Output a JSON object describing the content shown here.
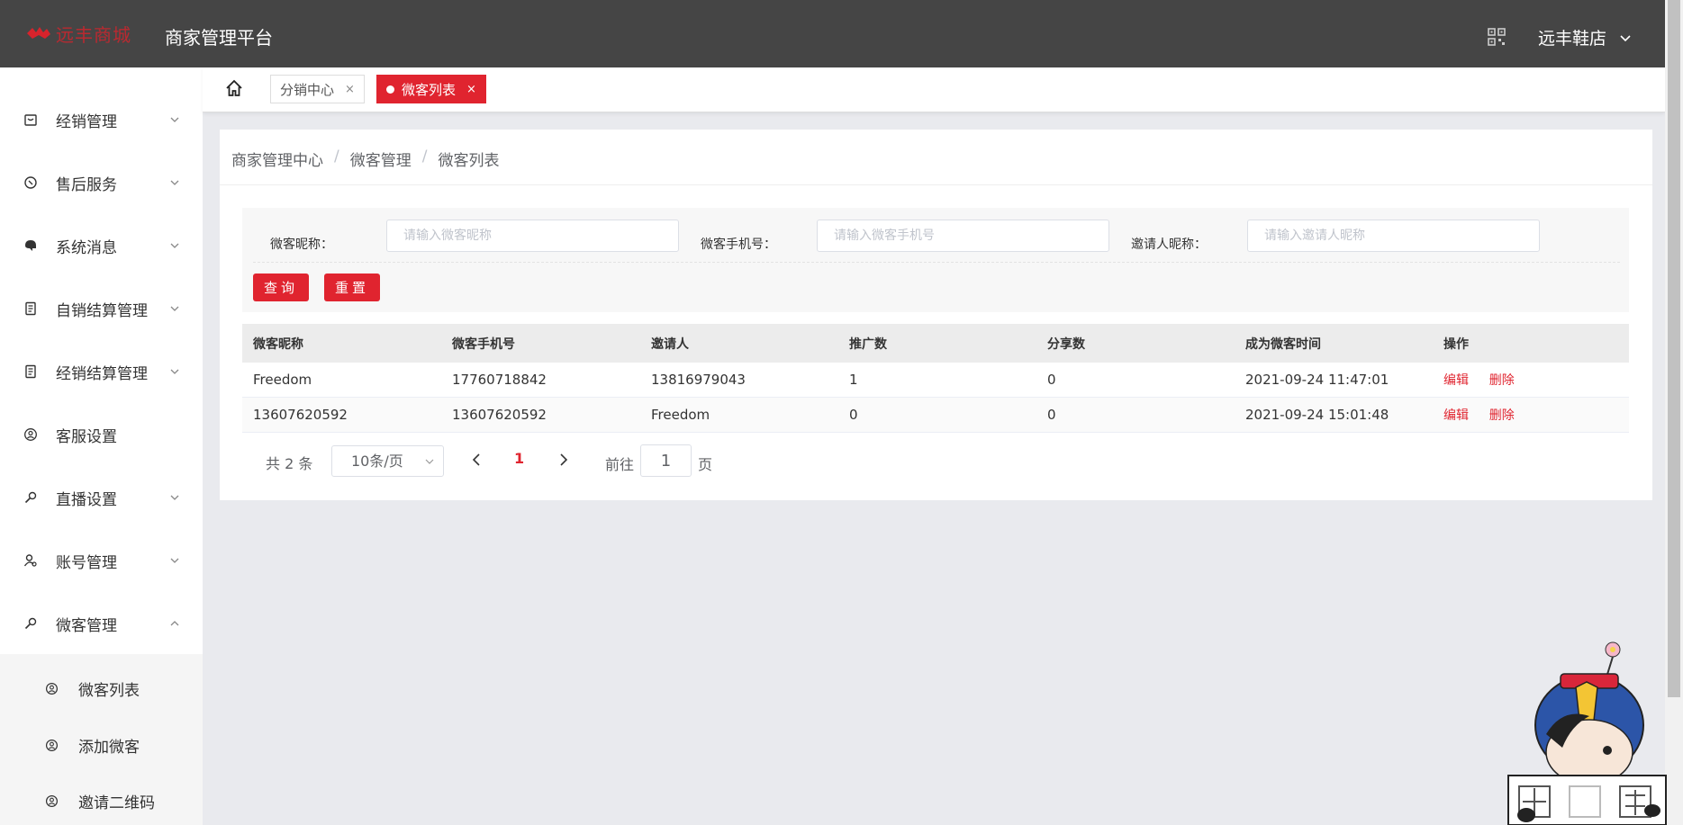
{
  "header": {
    "logo_text": "远丰商城",
    "platform_title": "商家管理平台",
    "shop_name": "远丰鞋店"
  },
  "sidebar": {
    "items": [
      {
        "label": "经销管理",
        "icon": "bag-icon",
        "expandable": true
      },
      {
        "label": "售后服务",
        "icon": "service-icon",
        "expandable": true
      },
      {
        "label": "系统消息",
        "icon": "message-icon",
        "expandable": true
      },
      {
        "label": "自销结算管理",
        "icon": "document-icon",
        "expandable": true
      },
      {
        "label": "经销结算管理",
        "icon": "document-icon",
        "expandable": true
      },
      {
        "label": "客服设置",
        "icon": "user-circle-icon",
        "expandable": false
      },
      {
        "label": "直播设置",
        "icon": "key-icon",
        "expandable": true
      },
      {
        "label": "账号管理",
        "icon": "account-icon",
        "expandable": true
      },
      {
        "label": "微客管理",
        "icon": "key-icon",
        "expandable": true,
        "expanded": true
      }
    ],
    "subitems": [
      {
        "label": "微客列表"
      },
      {
        "label": "添加微客"
      },
      {
        "label": "邀请二维码"
      }
    ]
  },
  "tabs": [
    {
      "label": "分销中心",
      "active": false
    },
    {
      "label": "微客列表",
      "active": true
    }
  ],
  "breadcrumb": [
    "商家管理中心",
    "微客管理",
    "微客列表"
  ],
  "filter": {
    "nickname_label": "微客昵称：",
    "nickname_placeholder": "请输入微客昵称",
    "phone_label": "微客手机号：",
    "phone_placeholder": "请输入微客手机号",
    "inviter_label": "邀请人昵称：",
    "inviter_placeholder": "请输入邀请人昵称",
    "query_label": "查询",
    "reset_label": "重置"
  },
  "table": {
    "columns": [
      "微客昵称",
      "微客手机号",
      "邀请人",
      "推广数",
      "分享数",
      "成为微客时间",
      "操作"
    ],
    "rows": [
      [
        "Freedom",
        "17760718842",
        "13816979043",
        "1",
        "0",
        "2021-09-24 11:47:01"
      ],
      [
        "13607620592",
        "13607620592",
        "Freedom",
        "0",
        "0",
        "2021-09-24 15:01:48"
      ]
    ],
    "edit_label": "编辑",
    "delete_label": "删除"
  },
  "pagination": {
    "total_text": "共 2 条",
    "page_size": "10条/页",
    "current_page": "1",
    "goto_prefix": "前往",
    "goto_value": "1",
    "goto_suffix": "页"
  },
  "colors": {
    "accent": "#e0242f",
    "header_bg": "#454545",
    "page_bg": "#e9eaee"
  }
}
